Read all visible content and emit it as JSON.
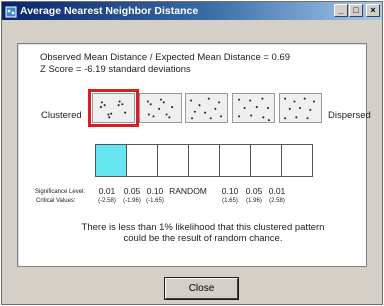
{
  "window": {
    "title": "Average Nearest Neighbor Distance",
    "minimize_glyph": "_",
    "maximize_glyph": "□",
    "close_glyph": "×"
  },
  "info": {
    "ratio_line": "Observed Mean Distance / Expected Mean Distance = 0.69",
    "zscore_line": "Z Score = -6.19 standard deviations"
  },
  "labels": {
    "clustered": "Clustered",
    "dispersed": "Dispersed",
    "significance": "Significance Level:",
    "critical": "Critical Values:"
  },
  "patterns": [
    {
      "icon": "clustered-points",
      "selected": true
    },
    {
      "icon": "somewhat-clustered-points",
      "selected": false
    },
    {
      "icon": "random-points",
      "selected": false
    },
    {
      "icon": "somewhat-dispersed-points",
      "selected": false
    },
    {
      "icon": "dispersed-points",
      "selected": false
    }
  ],
  "bar": {
    "cells": 7,
    "active_index": 0,
    "active_color": "#66e6f0"
  },
  "significance_levels": [
    "0.01",
    "0.05",
    "0.10",
    "RANDOM",
    "0.10",
    "0.05",
    "0.01"
  ],
  "critical_values": [
    "(-2.58)",
    "(-1.96)",
    "(-1.65)",
    "",
    "(1.65)",
    "(1.96)",
    "(2.58)"
  ],
  "message": "There is less than 1% likelihood that this clustered pattern could be the result of random chance.",
  "buttons": {
    "close": "Close"
  },
  "colors": {
    "title_bar_start": "#0a246a",
    "selection_outline": "#d81e1e",
    "window_background": "#d4d0c8"
  }
}
